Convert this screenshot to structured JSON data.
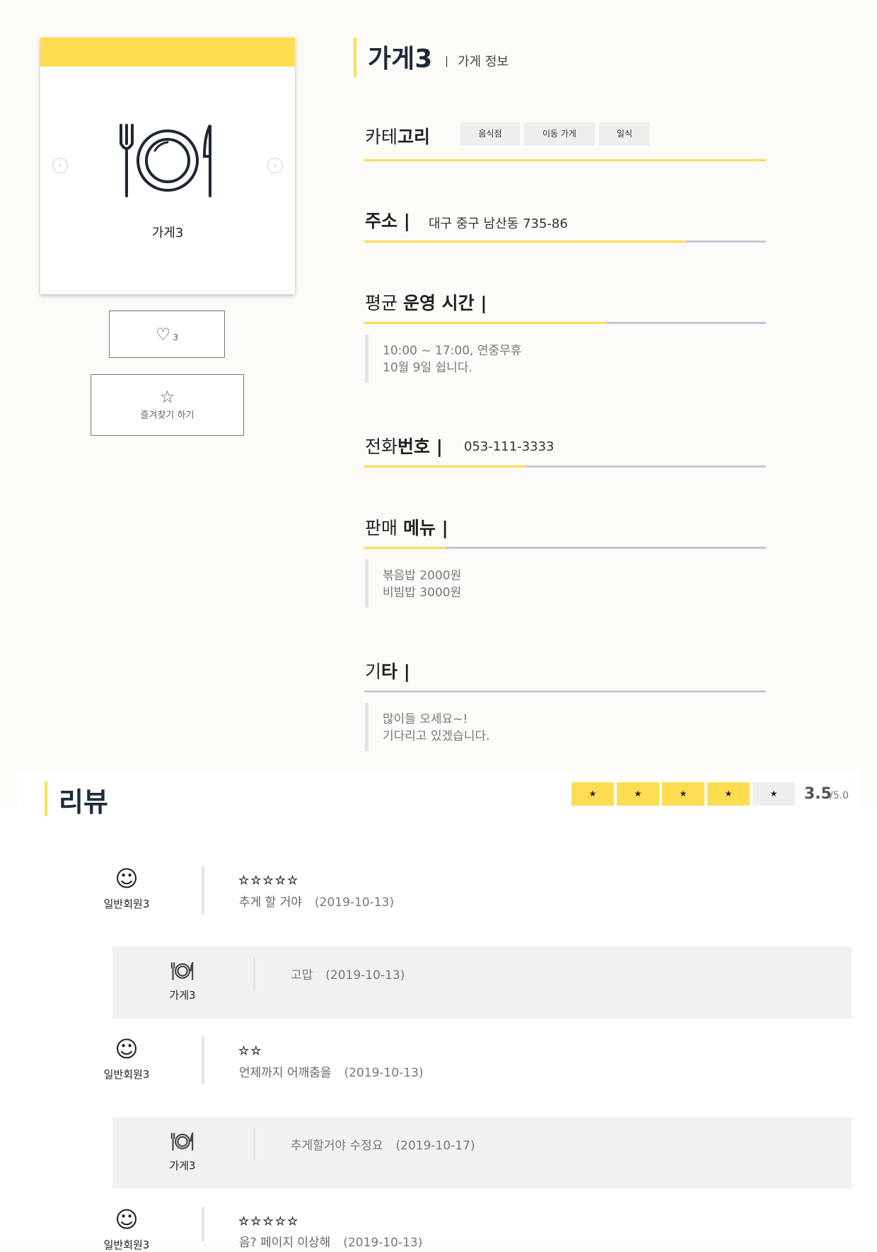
{
  "store": {
    "name": "가게3",
    "card_name": "가게3",
    "subtitle": "가게 정보",
    "title_separator": "|",
    "prev_label": "‹",
    "next_label": "›"
  },
  "like": {
    "heart": "♡",
    "count": "3"
  },
  "favorite": {
    "star": "☆",
    "label": "즐겨찾기 하기"
  },
  "sections": {
    "category": {
      "head_plain": "카테",
      "head_bold": "고리",
      "chips": [
        "음식점",
        "이동 가게",
        "일식"
      ],
      "progress": 1.0
    },
    "address": {
      "head_bold": "주소 |",
      "value": "대구 중구 남산동 735-86",
      "progress": 0.8
    },
    "hours": {
      "head_plain": "평균 ",
      "head_bold": "운영 시간 |",
      "lines": [
        "10:00 ~ 17:00, 연중무휴",
        "10월 9일 쉽니다."
      ],
      "progress": 0.6
    },
    "phone": {
      "head_plain": "전화",
      "head_bold": "번호 |",
      "value": "053-111-3333",
      "progress": 0.4
    },
    "menu": {
      "head_plain": "판매 ",
      "head_bold": "메뉴 |",
      "lines": [
        "볶음밥 2000원",
        "비빔밥 3000원"
      ],
      "progress": 0.2
    },
    "etc": {
      "head_plain": "기",
      "head_bold": "타 |",
      "lines": [
        "많이들 오세요~!",
        "기다리고 있겠습니다."
      ],
      "progress": 0.0
    }
  },
  "review": {
    "title": "리뷰",
    "rating_star": "★",
    "rating": "3.5",
    "rating_max": "/5.0",
    "rating_filled": 4,
    "accent_color": "#ffdd52",
    "items": [
      {
        "user": "일반회원3",
        "avatar": "☺",
        "stars": "☆☆☆☆☆",
        "text": "추게 할 거야",
        "date": "(2019-10-13)"
      },
      {
        "user": "일반회원3",
        "avatar": "☺",
        "stars": "☆☆",
        "text": "언제까지 어깨춤을",
        "date": "(2019-10-13)"
      },
      {
        "user": "일반회원3",
        "avatar": "☺",
        "stars": "☆☆☆☆☆",
        "text": "음? 페이지 이상해",
        "date": "(2019-10-13)"
      }
    ],
    "replies": [
      {
        "name": "가게3",
        "text": "고맙",
        "date": "(2019-10-13)"
      },
      {
        "name": "가게3",
        "text": "추게할거야 수정요",
        "date": "(2019-10-17)"
      }
    ]
  }
}
